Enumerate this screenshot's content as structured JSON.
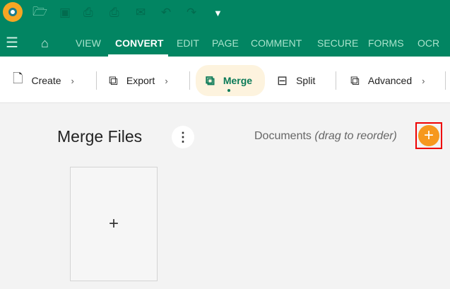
{
  "app": {
    "brand_color": "#028562",
    "accent": "#f6981e"
  },
  "quick_access": [
    "open-icon",
    "save-icon",
    "print-icon",
    "scan-print-icon",
    "email-icon",
    "undo-icon",
    "redo-icon",
    "chevron-down-icon"
  ],
  "nav": {
    "tabs": [
      "VIEW",
      "CONVERT",
      "EDIT",
      "PAGE",
      "COMMENT",
      "SECURE",
      "FORMS",
      "OCR"
    ],
    "active": "CONVERT"
  },
  "ribbon": {
    "create": "Create",
    "export": "Export",
    "merge": "Merge",
    "split": "Split",
    "advanced": "Advanced"
  },
  "main": {
    "title": "Merge Files",
    "docs_label": "Documents",
    "docs_hint": "(drag to reorder)",
    "add_symbol": "+",
    "drop_symbol": "+",
    "more_symbol": "⋮"
  }
}
